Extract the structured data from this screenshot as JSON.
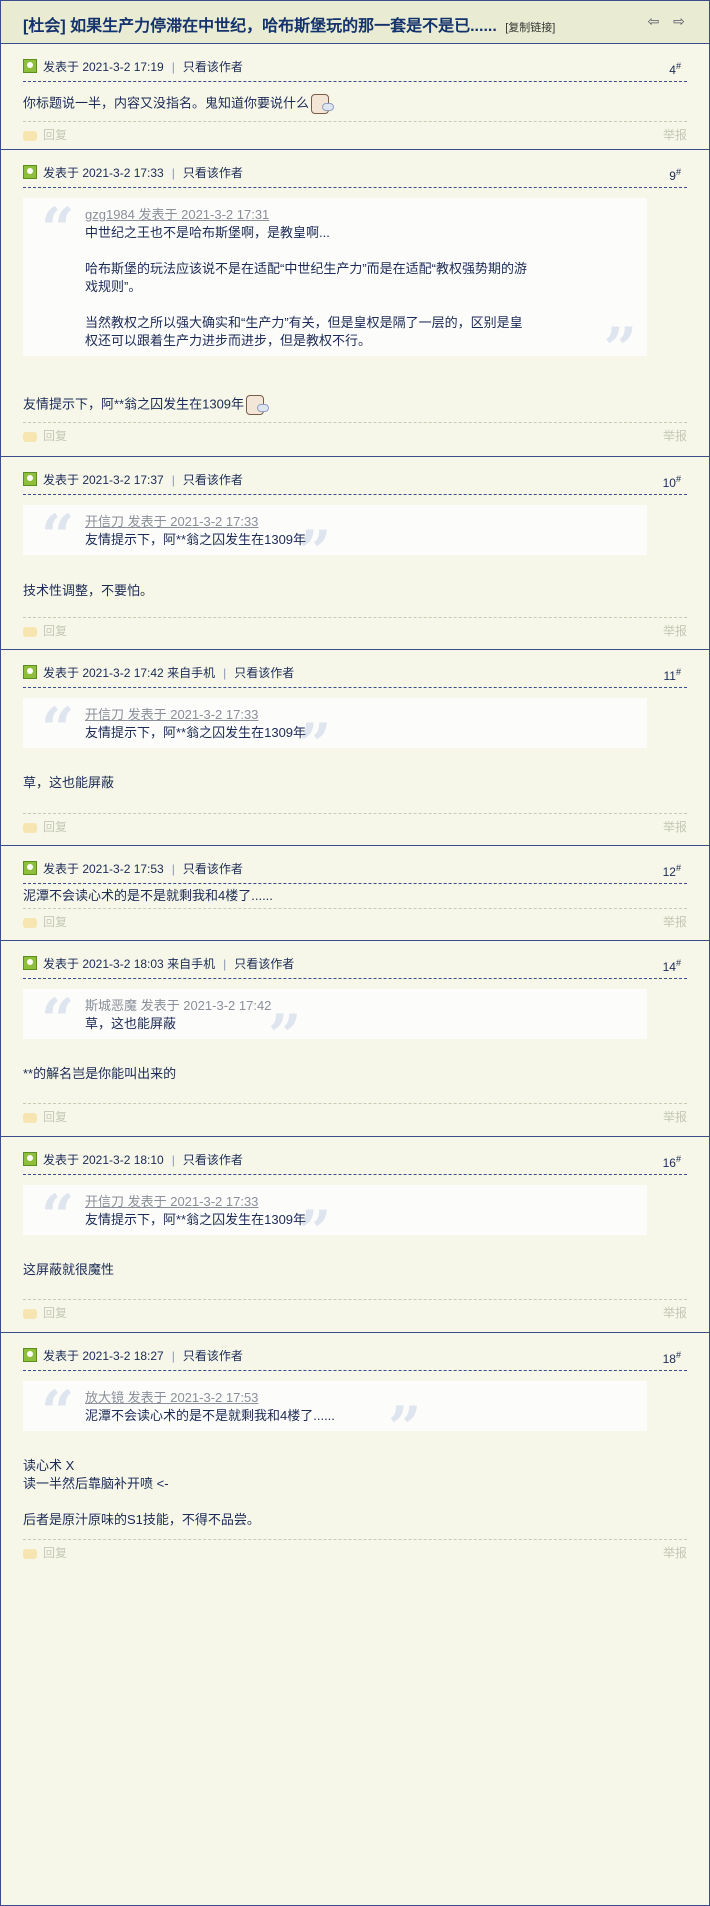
{
  "thread": {
    "title": "[杜会] 如果生产力停滞在中世纪，哈布斯堡玩的那一套是不是已......",
    "copy_link": "[复制链接]"
  },
  "common": {
    "reply": "回复",
    "report": "举报",
    "only_author": "只看该作者"
  },
  "posts": [
    {
      "meta": "发表于 2021-3-2 17:19",
      "floor": "4",
      "body": [
        "你标题说一半，内容又没指名。鬼知道你要说什么"
      ]
    },
    {
      "meta": "发表于 2021-3-2 17:33",
      "floor": "9",
      "quote": {
        "head": "gzg1984 发表于 2021-3-2 17:31",
        "lines": [
          "中世纪之王也不是哈布斯堡啊，是教皇啊...",
          "",
          "哈布斯堡的玩法应该说不是在适配“中世纪生产力”而是在适配“教权强势期的游",
          "戏规则”。",
          "",
          "当然教权之所以强大确实和“生产力”有关，但是皇权是隔了一层的，区别是皇",
          "权还可以跟着生产力进步而进步，但是教权不行。"
        ]
      },
      "body": [
        "友情提示下，阿**翁之囚发生在1309年"
      ]
    },
    {
      "meta": "发表于 2021-3-2 17:37",
      "floor": "10",
      "quote": {
        "head": "开信刀 发表于 2021-3-2 17:33",
        "lines": [
          "友情提示下，阿**翁之囚发生在1309年"
        ]
      },
      "body": [
        "技术性调整，不要怕。"
      ]
    },
    {
      "meta": "发表于 2021-3-2 17:42 来自手机",
      "floor": "11",
      "quote": {
        "head": "开信刀 发表于 2021-3-2 17:33",
        "lines": [
          "友情提示下，阿**翁之囚发生在1309年"
        ]
      },
      "body": [
        "草，这也能屏蔽"
      ]
    },
    {
      "meta": "发表于 2021-3-2 17:53",
      "floor": "12",
      "body": [
        "泥潭不会读心术的是不是就剩我和4楼了......"
      ]
    },
    {
      "meta": "发表于 2021-3-2 18:03 来自手机",
      "floor": "14",
      "quote": {
        "head": "斯城恶魔 发表于 2021-3-2 17:42",
        "lines": [
          "草，这也能屏蔽"
        ]
      },
      "body": [
        "**的解名岂是你能叫出来的"
      ]
    },
    {
      "meta": "发表于 2021-3-2 18:10",
      "floor": "16",
      "quote": {
        "head": "开信刀 发表于 2021-3-2 17:33",
        "lines": [
          "友情提示下，阿**翁之囚发生在1309年"
        ]
      },
      "body": [
        "这屏蔽就很魔性"
      ]
    },
    {
      "meta": "发表于 2021-3-2 18:27",
      "floor": "18",
      "quote": {
        "head": "放大镜 发表于 2021-3-2 17:53",
        "lines": [
          "泥潭不会读心术的是不是就剩我和4楼了......"
        ]
      },
      "body": [
        "读心术 X",
        "读一半然后靠脑补开喷 <-",
        "",
        "后者是原汁原味的S1技能，不得不品尝。"
      ]
    }
  ]
}
